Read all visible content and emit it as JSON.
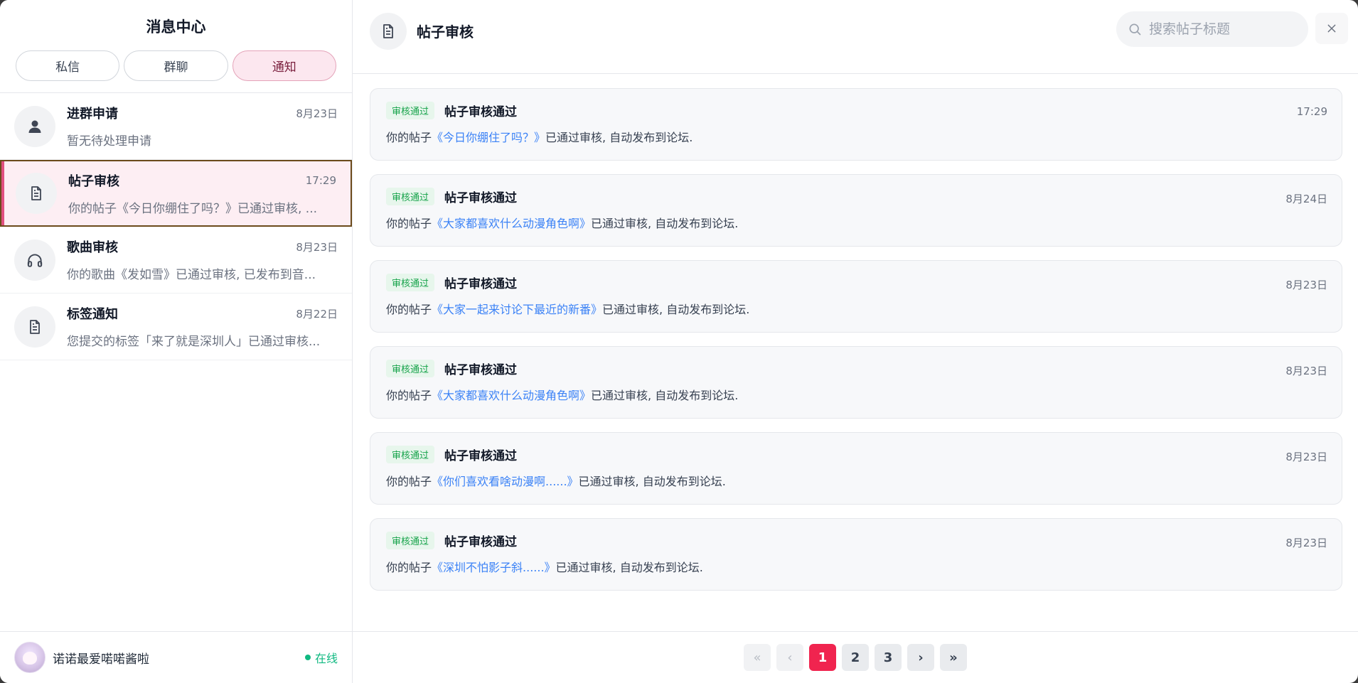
{
  "sidebar": {
    "title": "消息中心",
    "tabs": [
      {
        "label": "私信",
        "active": false
      },
      {
        "label": "群聊",
        "active": false
      },
      {
        "label": "通知",
        "active": true
      }
    ],
    "conversations": [
      {
        "name": "进群申请",
        "time": "8月23日",
        "preview": "暂无待处理申请",
        "icon": "user-icon"
      },
      {
        "name": "帖子审核",
        "time": "17:29",
        "preview": "你的帖子《今日你绷住了吗？》已通过审核, ...",
        "icon": "document-icon"
      },
      {
        "name": "歌曲审核",
        "time": "8月23日",
        "preview": "你的歌曲《发如雪》已通过审核, 已发布到音...",
        "icon": "headphones-icon"
      },
      {
        "name": "标签通知",
        "time": "8月22日",
        "preview": "您提交的标签「来了就是深圳人」已通过审核...",
        "icon": "document-icon"
      }
    ],
    "user": {
      "name": "诺诺最爱喏喏酱啦",
      "status": "在线"
    }
  },
  "main": {
    "title": "帖子审核",
    "search_placeholder": "搜索帖子标题",
    "notifications": [
      {
        "badge": "审核通过",
        "title": "帖子审核通过",
        "time": "17:29",
        "prefix": "你的帖子",
        "link": "《今日你绷住了吗？》",
        "suffix": "已通过审核, 自动发布到论坛."
      },
      {
        "badge": "审核通过",
        "title": "帖子审核通过",
        "time": "8月24日",
        "prefix": "你的帖子",
        "link": "《大家都喜欢什么动漫角色啊》",
        "suffix": "已通过审核, 自动发布到论坛."
      },
      {
        "badge": "审核通过",
        "title": "帖子审核通过",
        "time": "8月23日",
        "prefix": "你的帖子",
        "link": "《大家一起来讨论下最近的新番》",
        "suffix": "已通过审核, 自动发布到论坛."
      },
      {
        "badge": "审核通过",
        "title": "帖子审核通过",
        "time": "8月23日",
        "prefix": "你的帖子",
        "link": "《大家都喜欢什么动漫角色啊》",
        "suffix": "已通过审核, 自动发布到论坛."
      },
      {
        "badge": "审核通过",
        "title": "帖子审核通过",
        "time": "8月23日",
        "prefix": "你的帖子",
        "link": "《你们喜欢看啥动漫啊......》",
        "suffix": "已通过审核, 自动发布到论坛."
      },
      {
        "badge": "审核通过",
        "title": "帖子审核通过",
        "time": "8月23日",
        "prefix": "你的帖子",
        "link": "《深圳不怕影子斜......》",
        "suffix": "已通过审核, 自动发布到论坛."
      }
    ],
    "pagination": {
      "first": "«",
      "prev": "‹",
      "next": "›",
      "last": "»",
      "pages": [
        "1",
        "2",
        "3"
      ],
      "current": "1"
    }
  },
  "colors": {
    "accent": "#f0244f",
    "link": "#3b82f6",
    "success": "#16a34a",
    "active_tab_bg": "#fce7ef"
  }
}
